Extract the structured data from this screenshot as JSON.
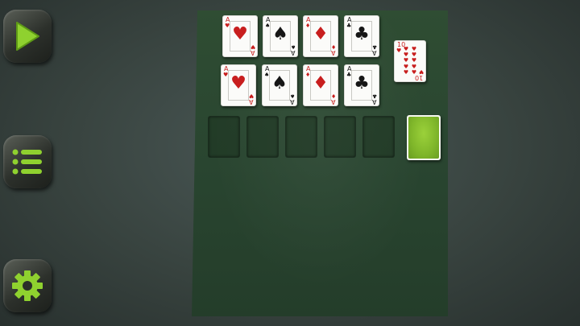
{
  "sidebar": {
    "play_icon": "play-icon",
    "menu_icon": "list-menu-icon",
    "settings_icon": "gear-icon",
    "accent": "#8fd12f"
  },
  "foundations": {
    "row1": [
      {
        "rank": "A",
        "suit": "♥",
        "color": "red"
      },
      {
        "rank": "A",
        "suit": "♠",
        "color": "black"
      },
      {
        "rank": "A",
        "suit": "♦",
        "color": "red"
      },
      {
        "rank": "A",
        "suit": "♣",
        "color": "black"
      }
    ],
    "row2": [
      {
        "rank": "A",
        "suit": "♥",
        "color": "red"
      },
      {
        "rank": "A",
        "suit": "♠",
        "color": "black"
      },
      {
        "rank": "A",
        "suit": "♦",
        "color": "red"
      },
      {
        "rank": "A",
        "suit": "♣",
        "color": "black"
      }
    ]
  },
  "waste_card": {
    "rank": "10",
    "suit": "♥",
    "color": "red"
  },
  "deck": {
    "back_color": "#8fc934"
  }
}
